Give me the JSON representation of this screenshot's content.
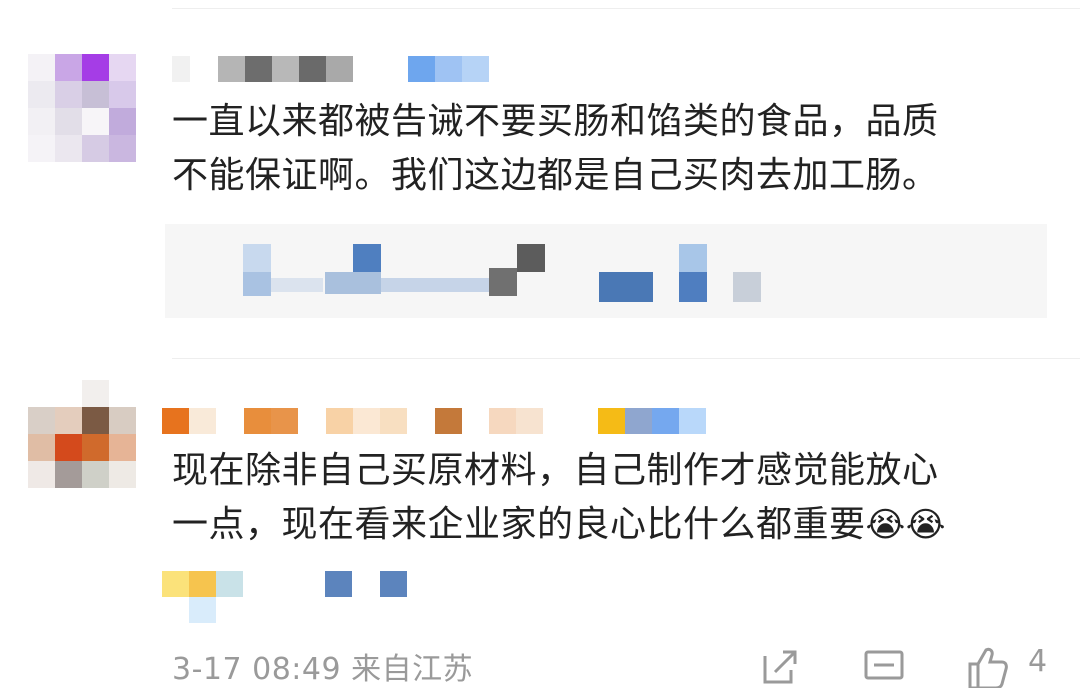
{
  "comments": [
    {
      "avatar": "pixelated-avatar",
      "username": "redacted-username",
      "text_line1": "一直以来都被告诫不要买肠和馅类的食品，品质",
      "text_line2": "不能保证啊。我们这边都是自己买肉去加工肠。",
      "reply_preview": "redacted-reply"
    },
    {
      "avatar": "pixelated-avatar",
      "username": "redacted-username",
      "text_line1": "现在除非自己买原材料，自己制作才感觉能放心",
      "text_line2": "一点，现在看来企业家的良心比什么都重要",
      "emoji": "😭😭",
      "meta": "3-17 08:49 来自江苏",
      "actions": {
        "share_icon": "share-icon",
        "comment_icon": "comment-icon",
        "like_icon": "thumbs-up-icon",
        "like_count": "4"
      }
    }
  ],
  "colors": {
    "text": "#222222",
    "meta": "#9a9a9a",
    "reply_bg": "#f6f6f6",
    "blur_blue": "#4a78b5"
  }
}
